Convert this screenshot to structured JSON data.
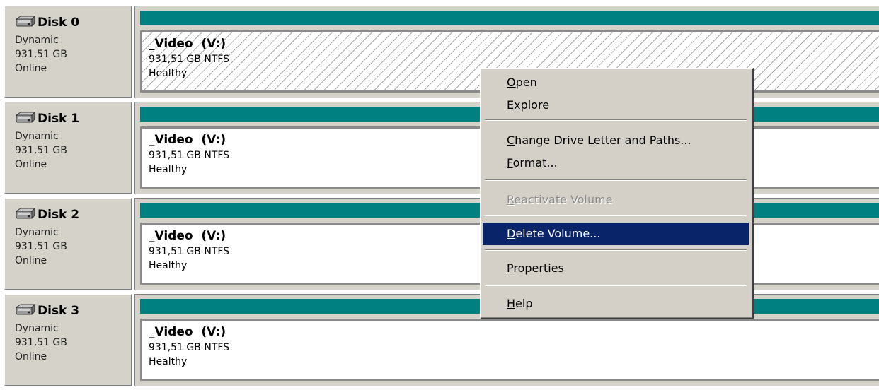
{
  "disks": [
    {
      "name": "Disk 0",
      "type": "Dynamic",
      "size": "931,51 GB",
      "status": "Online",
      "volume": {
        "name": "_Video  (V:)",
        "fs": "931,51 GB NTFS",
        "health": "Healthy",
        "selected": true
      }
    },
    {
      "name": "Disk 1",
      "type": "Dynamic",
      "size": "931,51 GB",
      "status": "Online",
      "volume": {
        "name": "_Video  (V:)",
        "fs": "931,51 GB NTFS",
        "health": "Healthy",
        "selected": false
      }
    },
    {
      "name": "Disk 2",
      "type": "Dynamic",
      "size": "931,51 GB",
      "status": "Online",
      "volume": {
        "name": "_Video  (V:)",
        "fs": "931,51 GB NTFS",
        "health": "Healthy",
        "selected": false
      }
    },
    {
      "name": "Disk 3",
      "type": "Dynamic",
      "size": "931,51 GB",
      "status": "Online",
      "volume": {
        "name": "_Video  (V:)",
        "fs": "931,51 GB NTFS",
        "health": "Healthy",
        "selected": false
      }
    }
  ],
  "context_menu": {
    "items": [
      {
        "first": "O",
        "rest": "pen",
        "state": "normal"
      },
      {
        "first": "E",
        "rest": "xplore",
        "state": "normal"
      },
      {
        "first": "C",
        "rest": "hange Drive Letter and Paths...",
        "state": "normal"
      },
      {
        "first": "F",
        "rest": "ormat...",
        "state": "normal"
      },
      {
        "first": "R",
        "rest": "eactivate Volume",
        "state": "disabled"
      },
      {
        "first": "D",
        "rest": "elete Volume...",
        "state": "highlighted"
      },
      {
        "first": "P",
        "rest": "roperties",
        "state": "normal"
      },
      {
        "first": "H",
        "rest": "elp",
        "state": "normal"
      }
    ]
  },
  "colors": {
    "volume_bar": "#008080",
    "menu_highlight": "#0a246a",
    "panel": "#d5d2ca"
  },
  "icons": {
    "disk": "hard-disk-icon"
  }
}
